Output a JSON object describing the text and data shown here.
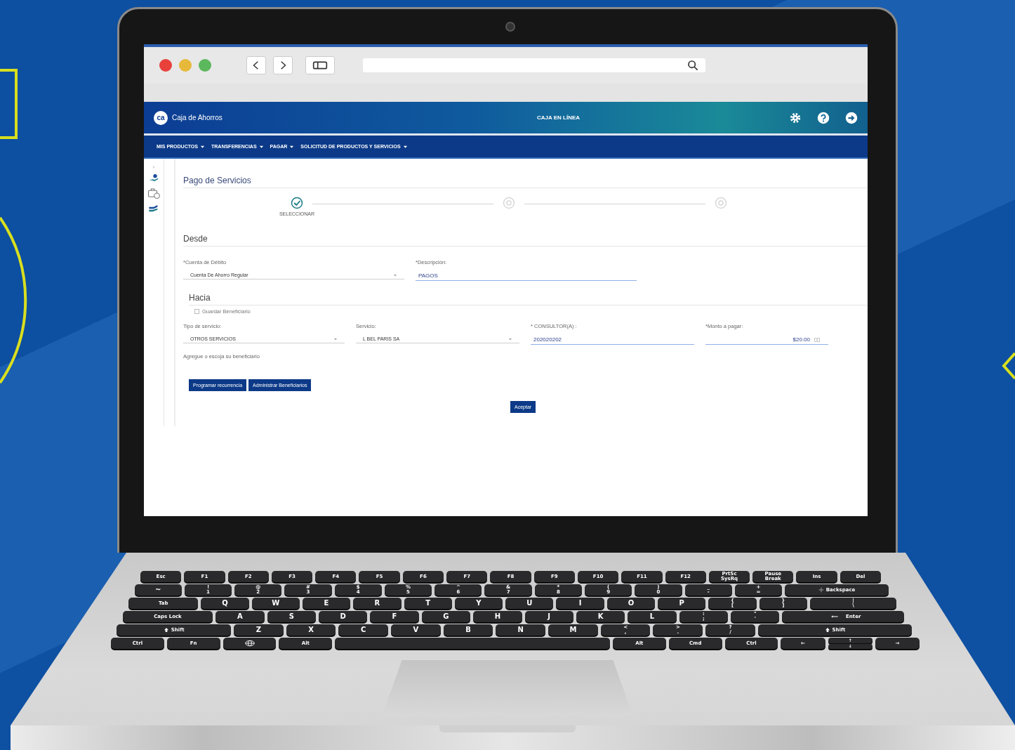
{
  "header": {
    "logo": "ca",
    "brand": "Caja de Ahorros",
    "title": "CAJA EN LÍNEA"
  },
  "nav": [
    {
      "label": "MIS PRODUCTOS"
    },
    {
      "label": "TRANSFERENCIAS"
    },
    {
      "label": "PAGAR"
    },
    {
      "label": "SOLICITUD DE PRODUCTOS Y SERVICIOS"
    }
  ],
  "page": {
    "title": "Pago de Servicios",
    "steps": [
      {
        "label": "SELECCIONAR",
        "done": true
      },
      {
        "done": false
      },
      {
        "done": false
      }
    ],
    "from": {
      "heading": "Desde",
      "fields": [
        {
          "kind": "select",
          "label": "*Cuenta de Débito",
          "value": "Cuenta De Ahorro Regular"
        },
        {
          "kind": "text",
          "label": "*Descripción:",
          "value": "PAGOS"
        }
      ]
    },
    "to": {
      "heading": "Hacia",
      "save": {
        "label": "Guardar Beneficiario",
        "checked": false
      },
      "fields": [
        {
          "kind": "select",
          "label": "Tipo de servicio:",
          "value": "OTROS SERVICIOS"
        },
        {
          "kind": "select",
          "label": "Servicio:",
          "value": "L BEL PARIS SA"
        },
        {
          "kind": "text",
          "label": "* CONSULTOR(A) :",
          "value": "202020202"
        },
        {
          "kind": "amount",
          "label": "*Monto a pagar:",
          "value": "$20.00"
        }
      ],
      "hint": "Agregue o escoja su beneficiario"
    },
    "actions": [
      "Programar recurrencia",
      "Administrar Beneficiarios"
    ],
    "submit": "Aceptar"
  },
  "keyboard": {
    "rows": [
      [
        {
          "kind": "fn",
          "label": "Esc"
        },
        {
          "kind": "fn",
          "label": "F1"
        },
        {
          "kind": "fn",
          "label": "F2"
        },
        {
          "kind": "fn",
          "label": "F3"
        },
        {
          "kind": "fn",
          "label": "F4"
        },
        {
          "kind": "fn",
          "label": "F5"
        },
        {
          "kind": "fn",
          "label": "F6"
        },
        {
          "kind": "fn",
          "label": "F7"
        },
        {
          "kind": "fn",
          "label": "F8"
        },
        {
          "kind": "fn",
          "label": "F9"
        },
        {
          "kind": "fn",
          "label": "F10"
        },
        {
          "kind": "fn",
          "label": "F11"
        },
        {
          "kind": "fn",
          "label": "F12"
        },
        {
          "kind": "fn",
          "top": "PrtSc",
          "label": "SysRq"
        },
        {
          "kind": "fn",
          "top": "Pause",
          "label": "Break"
        },
        {
          "kind": "fn",
          "label": "Ins"
        },
        {
          "kind": "fn",
          "label": "Del"
        }
      ],
      [
        {
          "kind": "key",
          "label": "~"
        },
        {
          "kind": "key",
          "top": "!",
          "label": "1"
        },
        {
          "kind": "key",
          "top": "@",
          "label": "2"
        },
        {
          "kind": "key",
          "top": "#",
          "label": "3"
        },
        {
          "kind": "key",
          "top": "$",
          "label": "4"
        },
        {
          "kind": "key",
          "top": "%",
          "label": "5"
        },
        {
          "kind": "key",
          "top": "^",
          "label": "6"
        },
        {
          "kind": "key",
          "top": "&",
          "label": "7"
        },
        {
          "kind": "key",
          "top": "*",
          "label": "8"
        },
        {
          "kind": "key",
          "top": "(",
          "label": "9"
        },
        {
          "kind": "key",
          "top": ")",
          "label": "0"
        },
        {
          "kind": "key",
          "top": "_",
          "label": "-"
        },
        {
          "kind": "key",
          "top": "+",
          "label": "="
        },
        {
          "kind": "backspace",
          "label": "Backspace"
        }
      ],
      [
        {
          "kind": "tab",
          "label": "Tab"
        },
        {
          "kind": "key",
          "label": "Q"
        },
        {
          "kind": "key",
          "label": "W"
        },
        {
          "kind": "key",
          "label": "E"
        },
        {
          "kind": "key",
          "label": "R"
        },
        {
          "kind": "key",
          "label": "T"
        },
        {
          "kind": "key",
          "label": "Y"
        },
        {
          "kind": "key",
          "label": "U"
        },
        {
          "kind": "key",
          "label": "I"
        },
        {
          "kind": "key",
          "label": "O"
        },
        {
          "kind": "key",
          "label": "P"
        },
        {
          "kind": "key",
          "top": "{",
          "label": "["
        },
        {
          "kind": "key",
          "top": "}",
          "label": "]"
        },
        {
          "kind": "wide",
          "top": "|",
          "label": "\\"
        }
      ],
      [
        {
          "kind": "caps",
          "label": "Caps Lock"
        },
        {
          "kind": "key",
          "label": "A"
        },
        {
          "kind": "key",
          "label": "S"
        },
        {
          "kind": "key",
          "label": "D"
        },
        {
          "kind": "key",
          "label": "F"
        },
        {
          "kind": "key",
          "label": "G"
        },
        {
          "kind": "key",
          "label": "H"
        },
        {
          "kind": "key",
          "label": "J"
        },
        {
          "kind": "key",
          "label": "K"
        },
        {
          "kind": "key",
          "label": "L"
        },
        {
          "kind": "key",
          "top": ":",
          "label": ";"
        },
        {
          "kind": "key",
          "top": "\"",
          "label": "'"
        },
        {
          "kind": "enter",
          "label": "Enter"
        }
      ],
      [
        {
          "kind": "shift",
          "label": "Shift"
        },
        {
          "kind": "key",
          "label": "Z"
        },
        {
          "kind": "key",
          "label": "X"
        },
        {
          "kind": "key",
          "label": "C"
        },
        {
          "kind": "key",
          "label": "V"
        },
        {
          "kind": "key",
          "label": "B"
        },
        {
          "kind": "key",
          "label": "N"
        },
        {
          "kind": "key",
          "label": "M"
        },
        {
          "kind": "key",
          "top": "<",
          "label": ","
        },
        {
          "kind": "key",
          "top": ">",
          "label": "."
        },
        {
          "kind": "key",
          "top": "?",
          "label": "/"
        },
        {
          "kind": "shift-right",
          "label": "Shift"
        }
      ],
      [
        {
          "kind": "mod",
          "label": "Ctrl"
        },
        {
          "kind": "mod",
          "label": "Fn"
        },
        {
          "kind": "globe"
        },
        {
          "kind": "mod",
          "label": "Alt"
        },
        {
          "kind": "space"
        },
        {
          "kind": "mod",
          "label": "Alt"
        },
        {
          "kind": "mod",
          "label": "Cmd"
        },
        {
          "kind": "mod",
          "label": "Ctrl"
        },
        {
          "kind": "arrow",
          "label": "←"
        },
        {
          "kind": "arrow-pair",
          "top": "↑",
          "label": "↓"
        },
        {
          "kind": "arrow",
          "label": "→"
        }
      ]
    ]
  }
}
